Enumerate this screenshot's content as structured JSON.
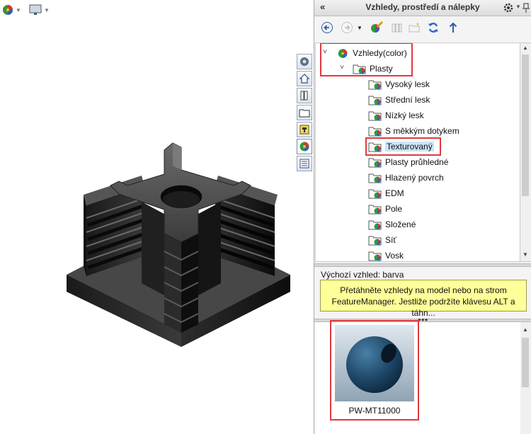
{
  "viewport": {
    "toolbar": {
      "appearance_icon": "appearance-sphere-icon",
      "display_icon": "monitor-icon"
    },
    "model": "black plastic insert part"
  },
  "task_tabs": [
    {
      "name": "solidworks-resources-tab",
      "icon": "gear-globe-icon"
    },
    {
      "name": "home-tab",
      "icon": "home-icon"
    },
    {
      "name": "design-library-tab",
      "icon": "library-books-icon"
    },
    {
      "name": "file-explorer-tab",
      "icon": "folder-icon"
    },
    {
      "name": "view-palette-tab",
      "icon": "view-palette-icon"
    },
    {
      "name": "appearances-tab",
      "icon": "color-sphere-icon",
      "active": true
    },
    {
      "name": "custom-properties-tab",
      "icon": "properties-list-icon"
    }
  ],
  "pane": {
    "title": "Vzhledy, prostředí a nálepky",
    "collapse_glyph": "«",
    "toolbar": [
      {
        "name": "back-button",
        "icon": "back-arrow-icon"
      },
      {
        "name": "forward-button",
        "icon": "forward-arrow-icon"
      },
      {
        "name": "history-dropdown",
        "icon": "dropdown-arrow-icon"
      },
      {
        "name": "add-to-library-button",
        "icon": "add-appearance-icon"
      },
      {
        "name": "add-file-location-button",
        "icon": "library-add-icon"
      },
      {
        "name": "new-folder-button",
        "icon": "new-folder-icon"
      },
      {
        "name": "refresh-button",
        "icon": "refresh-icon"
      },
      {
        "name": "up-level-button",
        "icon": "up-arrow-icon"
      }
    ],
    "tree": {
      "root": {
        "label": "Vzhledy(color)",
        "expanded": true
      },
      "category": {
        "label": "Plasty",
        "expanded": true
      },
      "items": [
        {
          "label": "Vysoký lesk"
        },
        {
          "label": "Střední lesk"
        },
        {
          "label": "Nízký lesk"
        },
        {
          "label": "S měkkým dotykem"
        },
        {
          "label": "Texturovaný",
          "selected": true
        },
        {
          "label": "Plasty průhledné"
        },
        {
          "label": "Hlazený povrch"
        },
        {
          "label": "EDM"
        },
        {
          "label": "Pole"
        },
        {
          "label": "Složené"
        },
        {
          "label": "Síť"
        },
        {
          "label": "Vosk"
        }
      ]
    },
    "default_appearance_label": "Výchozí vzhled: barva",
    "tip_text_line1": "Přetáhněte vzhledy na model nebo na strom",
    "tip_text_line2": "FeatureManager. Jestliže podržíte klávesu ALT a táhn...",
    "gallery": [
      {
        "label": "PW-MT11000",
        "swatch_color": "#1f4a6b"
      }
    ]
  },
  "highlight_color": "#e0393e"
}
